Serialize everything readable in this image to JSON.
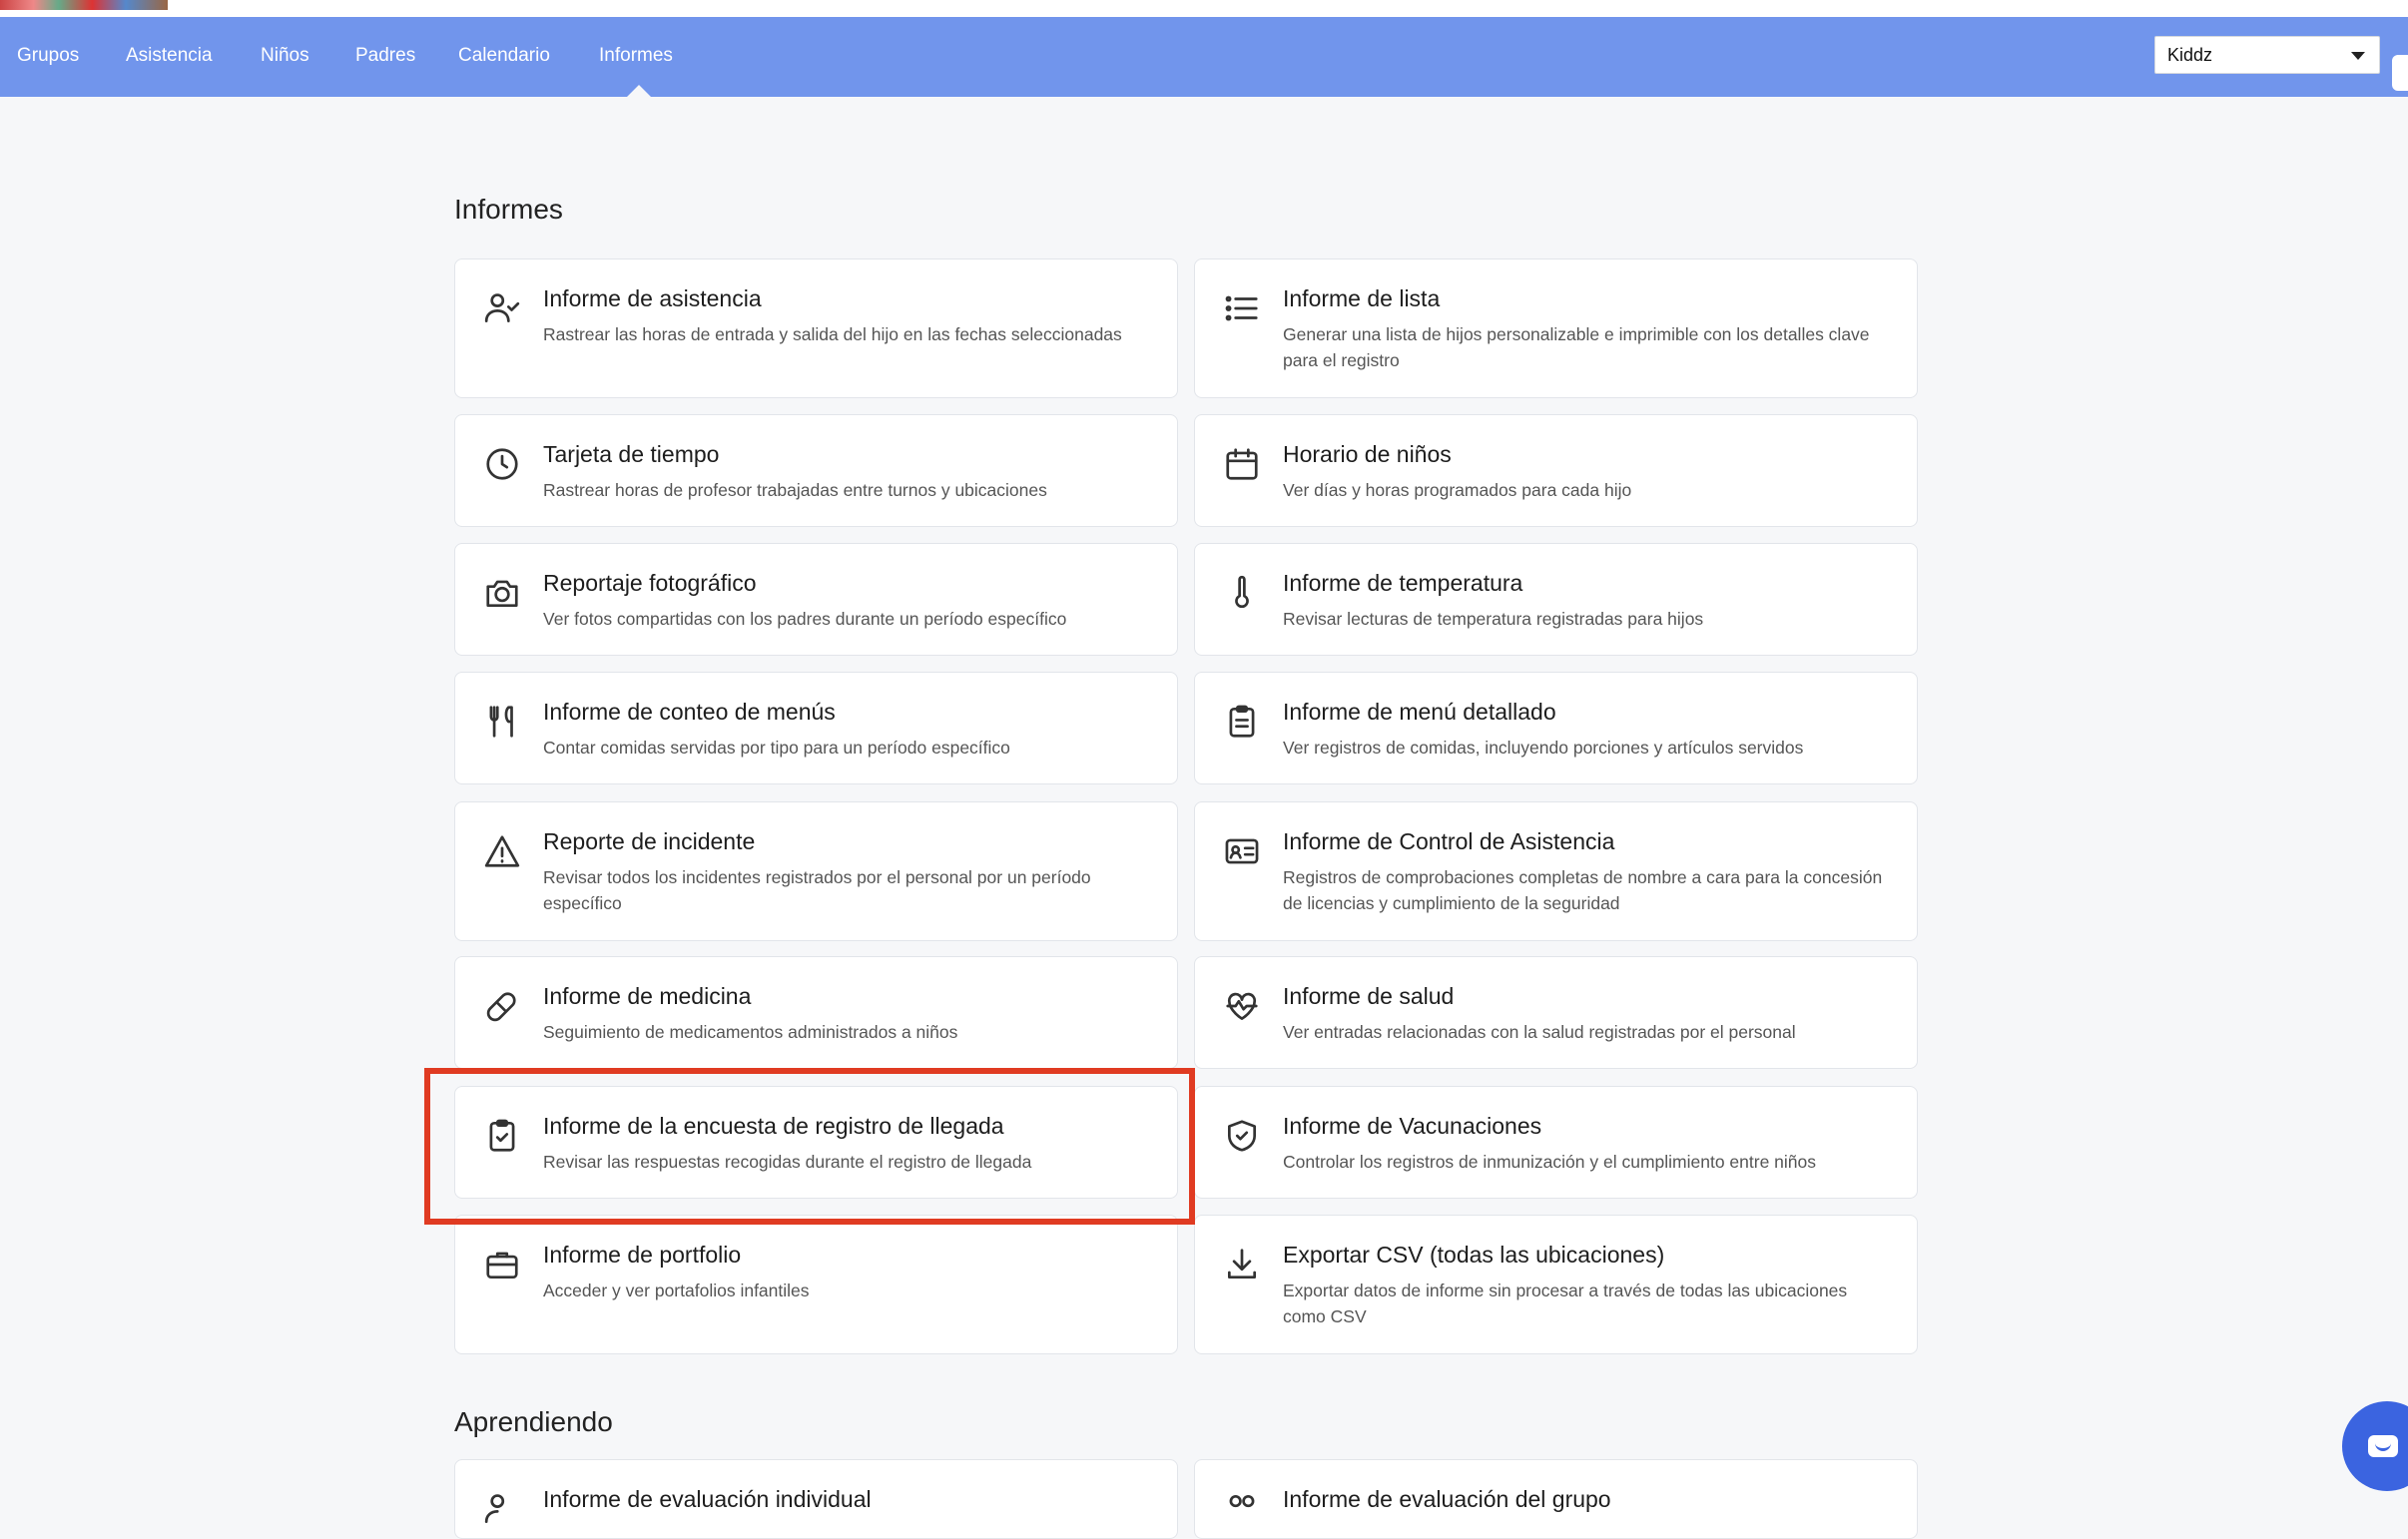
{
  "nav": {
    "items": [
      "Grupos",
      "Asistencia",
      "Niños",
      "Padres",
      "Calendario",
      "Informes"
    ],
    "active": "Informes",
    "location_select": "Kiddz"
  },
  "reports_section": {
    "title": "Informes",
    "cards": [
      {
        "icon": "user-check-icon",
        "title": "Informe de asistencia",
        "desc": "Rastrear las horas de entrada y salida del hijo en las fechas seleccionadas"
      },
      {
        "icon": "list-icon",
        "title": "Informe de lista",
        "desc": "Generar una lista de hijos personalizable e imprimible con los detalles clave para el registro"
      },
      {
        "icon": "clock-icon",
        "title": "Tarjeta de tiempo",
        "desc": "Rastrear horas de profesor trabajadas entre turnos y ubicaciones"
      },
      {
        "icon": "calendar-icon",
        "title": "Horario de niños",
        "desc": "Ver días y horas programados para cada hijo"
      },
      {
        "icon": "camera-icon",
        "title": "Reportaje fotográfico",
        "desc": "Ver fotos compartidas con los padres durante un período específico"
      },
      {
        "icon": "thermometer-icon",
        "title": "Informe de temperatura",
        "desc": "Revisar lecturas de temperatura registradas para hijos"
      },
      {
        "icon": "utensils-icon",
        "title": "Informe de conteo de menús",
        "desc": "Contar comidas servidas por tipo para un período específico"
      },
      {
        "icon": "clipboard-icon",
        "title": "Informe de menú detallado",
        "desc": "Ver registros de comidas, incluyendo porciones y artículos servidos"
      },
      {
        "icon": "warning-icon",
        "title": "Reporte de incidente",
        "desc": "Revisar todos los incidentes registrados por el personal por un período específico"
      },
      {
        "icon": "id-card-icon",
        "title": "Informe de Control de Asistencia",
        "desc": "Registros de comprobaciones completas de nombre a cara para la concesión de licencias y cumplimiento de la seguridad"
      },
      {
        "icon": "pill-icon",
        "title": "Informe de medicina",
        "desc": "Seguimiento de medicamentos administrados a niños"
      },
      {
        "icon": "heart-pulse-icon",
        "title": "Informe de salud",
        "desc": "Ver entradas relacionadas con la salud registradas por el personal"
      },
      {
        "icon": "clipboard-check-icon",
        "title": "Informe de la encuesta de registro de llegada",
        "desc": "Revisar las respuestas recogidas durante el registro de llegada"
      },
      {
        "icon": "shield-check-icon",
        "title": "Informe de Vacunaciones",
        "desc": "Controlar los registros de inmunización y el cumplimiento entre niños"
      },
      {
        "icon": "briefcase-icon",
        "title": "Informe de portfolio",
        "desc": "Acceder y ver portafolios infantiles"
      },
      {
        "icon": "download-icon",
        "title": "Exportar CSV (todas las ubicaciones)",
        "desc": "Exportar datos de informe sin procesar a través de todas las ubicaciones como CSV"
      }
    ]
  },
  "learning_section": {
    "title": "Aprendiendo",
    "cards": [
      {
        "icon": "user-chart-icon",
        "title": "Informe de evaluación individual"
      },
      {
        "icon": "group-chart-icon",
        "title": "Informe de evaluación del grupo"
      }
    ]
  },
  "colors": {
    "nav_bg": "#7195ec",
    "highlight": "#e03b22",
    "chat": "#3b64e0"
  }
}
